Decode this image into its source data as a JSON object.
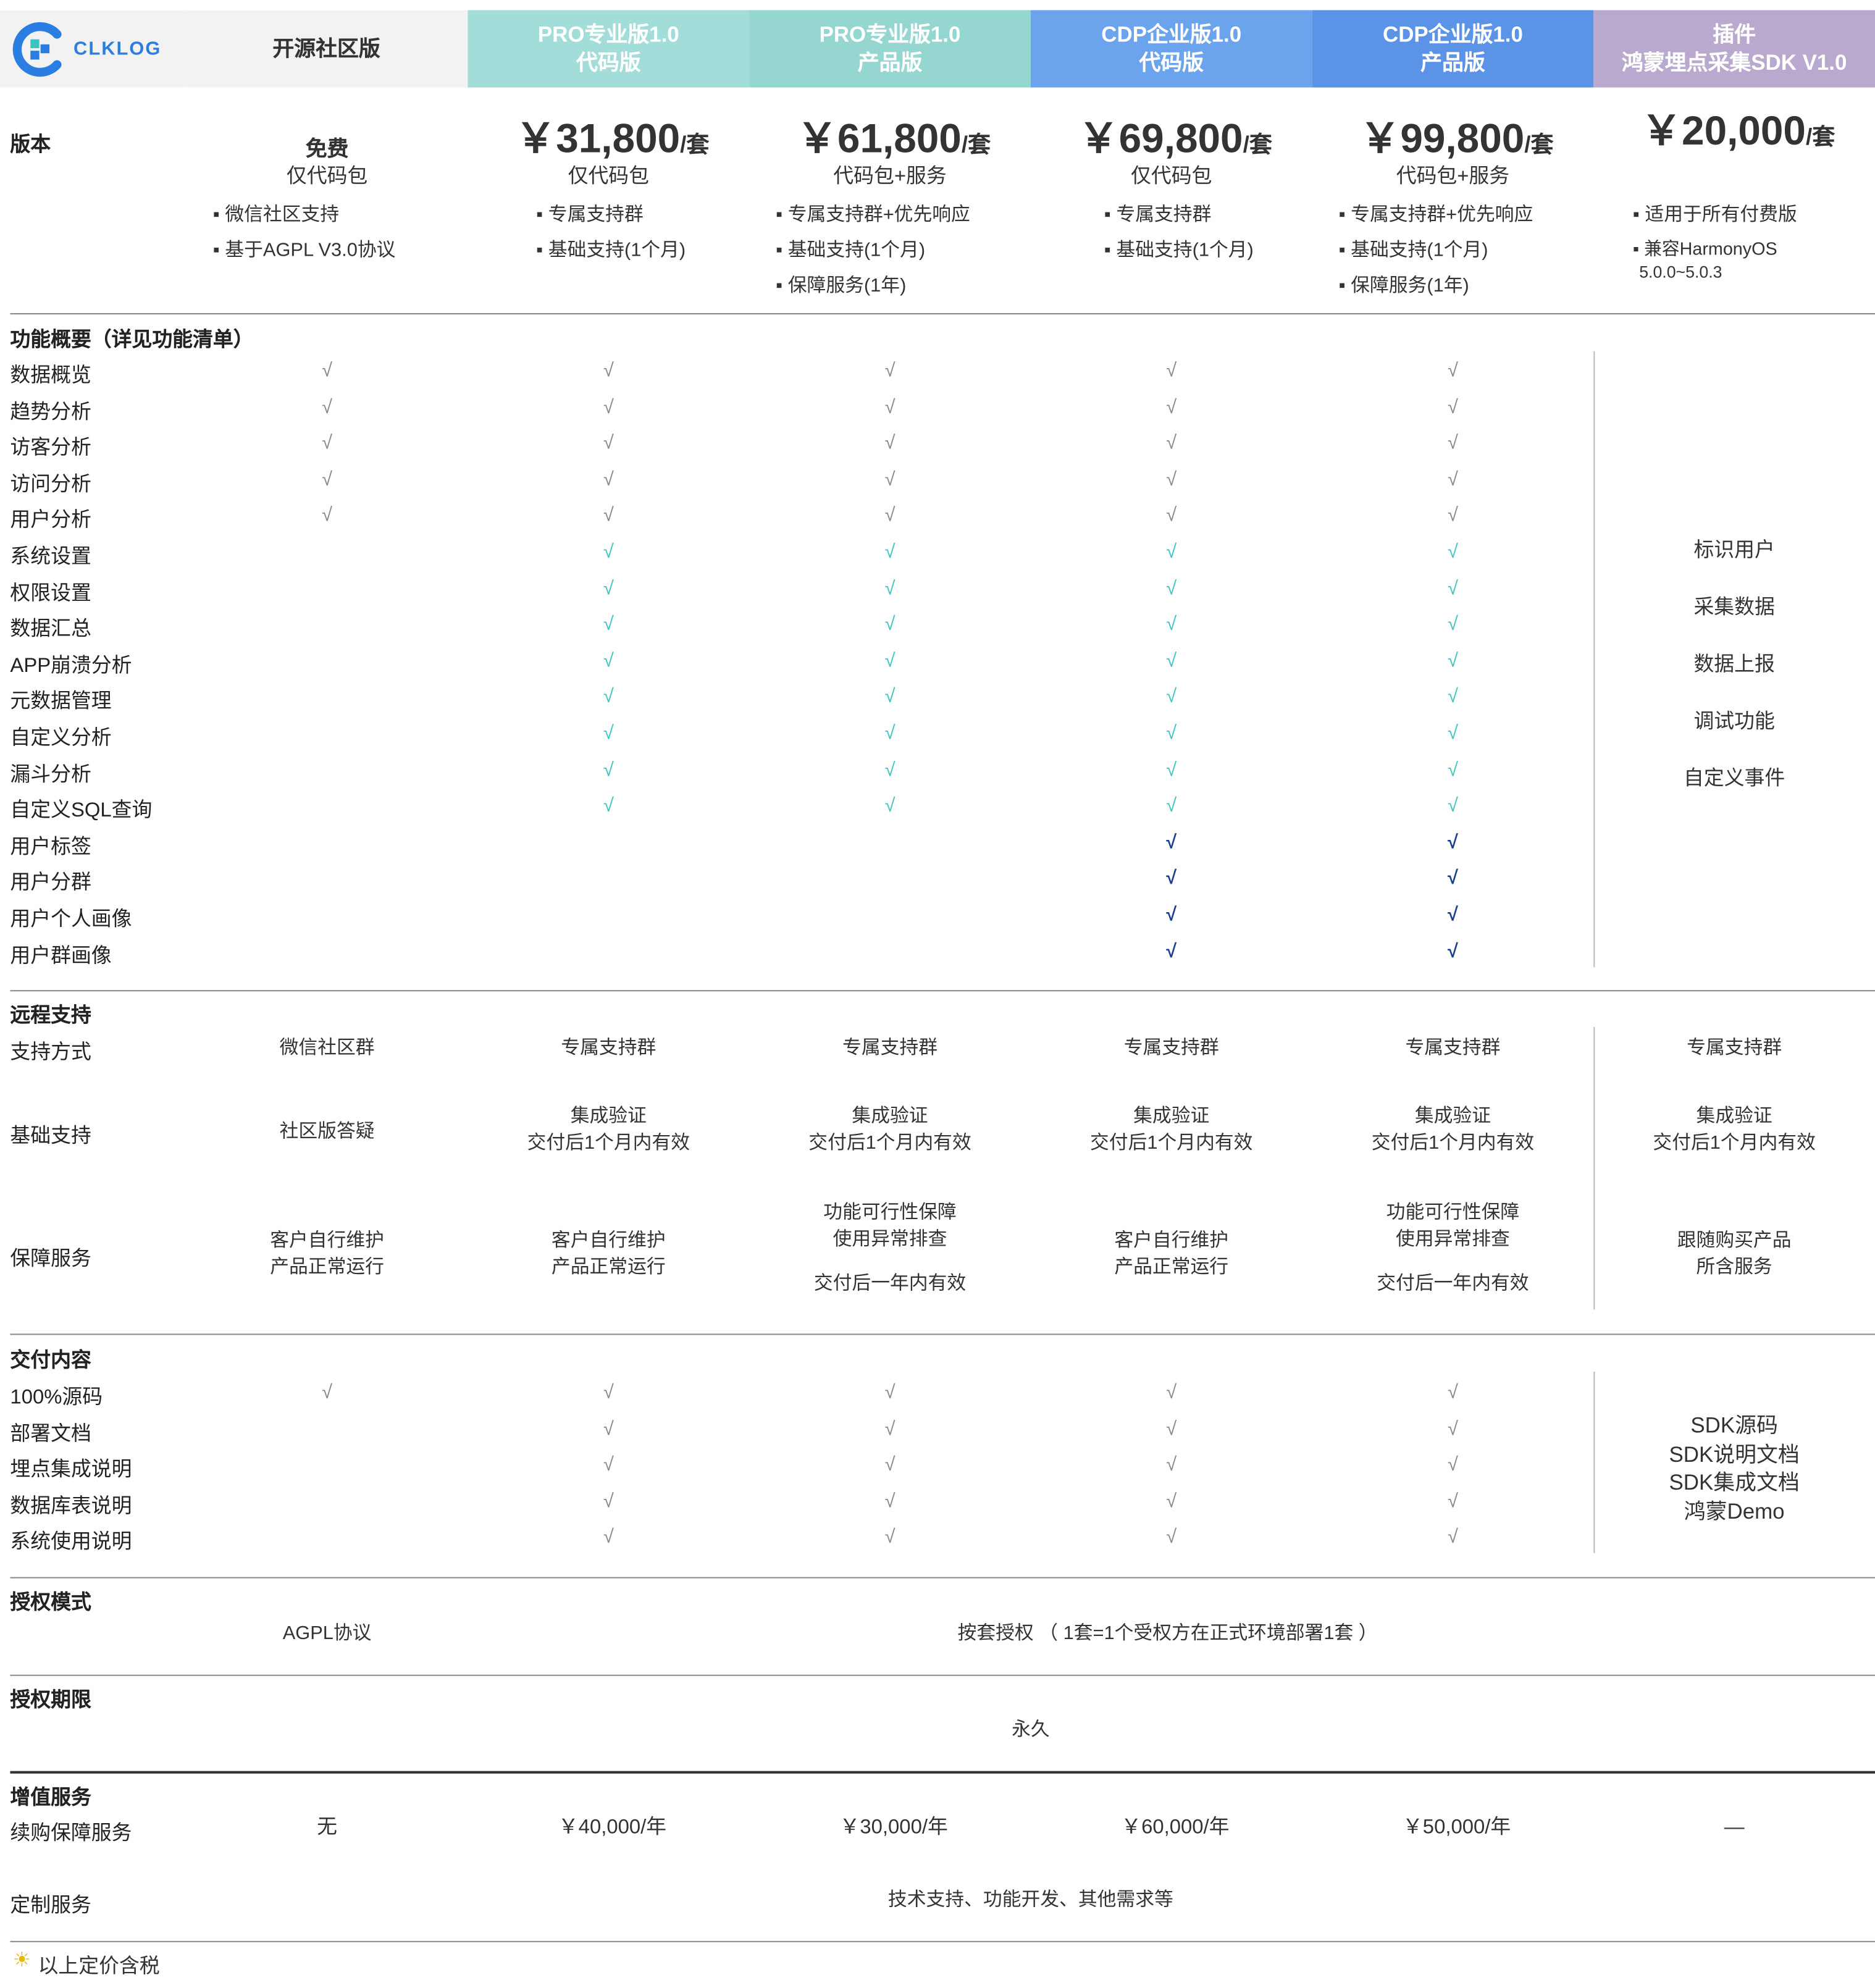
{
  "logo": {
    "text": "CLKLOG"
  },
  "columns": [
    {
      "line1": "开源社区版",
      "line2": "",
      "bg": "#f2f2f2",
      "fg": "#333333"
    },
    {
      "line1": "PRO专业版1.0",
      "line2": "代码版",
      "bg": "#a3ddd9",
      "fg": "#ffffff"
    },
    {
      "line1": "PRO专业版1.0",
      "line2": "产品版",
      "bg": "#95d6d1",
      "fg": "#ffffff"
    },
    {
      "line1": "CDP企业版1.0",
      "line2": "代码版",
      "bg": "#6ba3ec",
      "fg": "#ffffff"
    },
    {
      "line1": "CDP企业版1.0",
      "line2": "产品版",
      "bg": "#5b93e6",
      "fg": "#ffffff"
    },
    {
      "line1": "插件",
      "line2": "鸿蒙埋点采集SDK V1.0",
      "bg": "#b9a9cf",
      "fg": "#ffffff"
    }
  ],
  "version": {
    "label": "版本",
    "free": {
      "title": "免费",
      "sub": "仅代码包",
      "bullets": [
        "▪ 微信社区支持",
        "▪ 基于AGPL V3.0协议"
      ]
    },
    "prices": [
      {
        "amount": "￥31,800",
        "unit": "/套",
        "sub": "仅代码包",
        "bullets": [
          "▪ 专属支持群",
          "▪ 基础支持(1个月)"
        ]
      },
      {
        "amount": "￥61,800",
        "unit": "/套",
        "sub": "代码包+服务",
        "bullets": [
          "▪ 专属支持群+优先响应",
          "▪ 基础支持(1个月)",
          "▪ 保障服务(1年)"
        ]
      },
      {
        "amount": "￥69,800",
        "unit": "/套",
        "sub": "仅代码包",
        "bullets": [
          "▪ 专属支持群",
          "▪ 基础支持(1个月)"
        ]
      },
      {
        "amount": "￥99,800",
        "unit": "/套",
        "sub": "代码包+服务",
        "bullets": [
          "▪ 专属支持群+优先响应",
          "▪ 基础支持(1个月)",
          "▪ 保障服务(1年)"
        ]
      }
    ],
    "plugin": {
      "amount": "￥20,000",
      "unit": "/套",
      "bullets": [
        "▪ 适用于所有付费版",
        "▪ 兼容HarmonyOS",
        "5.0.0~5.0.3"
      ]
    }
  },
  "features": {
    "title": "功能概要（详见功能清单）",
    "check_mark": "√",
    "colors": {
      "gray": "#888888",
      "teal": "#3cc4c0",
      "navy": "#1b3f8f"
    },
    "rows": [
      {
        "name": "数据概览",
        "cols": [
          1,
          1,
          1,
          1,
          1
        ],
        "color": "gray"
      },
      {
        "name": "趋势分析",
        "cols": [
          1,
          1,
          1,
          1,
          1
        ],
        "color": "gray"
      },
      {
        "name": "访客分析",
        "cols": [
          1,
          1,
          1,
          1,
          1
        ],
        "color": "gray"
      },
      {
        "name": "访问分析",
        "cols": [
          1,
          1,
          1,
          1,
          1
        ],
        "color": "gray"
      },
      {
        "name": "用户分析",
        "cols": [
          1,
          1,
          1,
          1,
          1
        ],
        "color": "gray"
      },
      {
        "name": "系统设置",
        "cols": [
          0,
          1,
          1,
          1,
          1
        ],
        "color": "teal"
      },
      {
        "name": "权限设置",
        "cols": [
          0,
          1,
          1,
          1,
          1
        ],
        "color": "teal"
      },
      {
        "name": "数据汇总",
        "cols": [
          0,
          1,
          1,
          1,
          1
        ],
        "color": "teal"
      },
      {
        "name": "APP崩溃分析",
        "cols": [
          0,
          1,
          1,
          1,
          1
        ],
        "color": "teal"
      },
      {
        "name": "元数据管理",
        "cols": [
          0,
          1,
          1,
          1,
          1
        ],
        "color": "teal"
      },
      {
        "name": "自定义分析",
        "cols": [
          0,
          1,
          1,
          1,
          1
        ],
        "color": "teal"
      },
      {
        "name": "漏斗分析",
        "cols": [
          0,
          1,
          1,
          1,
          1
        ],
        "color": "teal"
      },
      {
        "name": "自定义SQL查询",
        "cols": [
          0,
          1,
          1,
          1,
          1
        ],
        "color": "teal"
      },
      {
        "name": "用户标签",
        "cols": [
          0,
          0,
          0,
          1,
          1
        ],
        "color": "navy"
      },
      {
        "name": "用户分群",
        "cols": [
          0,
          0,
          0,
          1,
          1
        ],
        "color": "navy"
      },
      {
        "name": "用户个人画像",
        "cols": [
          0,
          0,
          0,
          1,
          1
        ],
        "color": "navy"
      },
      {
        "name": "用户群画像",
        "cols": [
          0,
          0,
          0,
          1,
          1
        ],
        "color": "navy"
      }
    ],
    "plugin_items": [
      "标识用户",
      "采集数据",
      "数据上报",
      "调试功能",
      "自定义事件"
    ]
  },
  "remote": {
    "title": "远程支持",
    "rows": [
      {
        "name": "支持方式",
        "cells": [
          [
            "微信社区群"
          ],
          [
            "专属支持群"
          ],
          [
            "专属支持群"
          ],
          [
            "专属支持群"
          ],
          [
            "专属支持群"
          ],
          [
            "专属支持群"
          ]
        ]
      },
      {
        "name": "基础支持",
        "cells": [
          [
            "社区版答疑"
          ],
          [
            "集成验证",
            "交付后1个月内有效"
          ],
          [
            "集成验证",
            "交付后1个月内有效"
          ],
          [
            "集成验证",
            "交付后1个月内有效"
          ],
          [
            "集成验证",
            "交付后1个月内有效"
          ],
          [
            "集成验证",
            "交付后1个月内有效"
          ]
        ]
      },
      {
        "name": "保障服务",
        "cells": [
          [
            "客户自行维护",
            "产品正常运行"
          ],
          [
            "客户自行维护",
            "产品正常运行"
          ],
          [
            "功能可行性保障",
            "使用异常排查",
            "交付后一年内有效"
          ],
          [
            "客户自行维护",
            "产品正常运行"
          ],
          [
            "功能可行性保障",
            "使用异常排查",
            "交付后一年内有效"
          ],
          [
            "跟随购买产品",
            "所含服务"
          ]
        ]
      }
    ]
  },
  "delivery": {
    "title": "交付内容",
    "rows": [
      {
        "name": "100%源码",
        "cols": [
          1,
          1,
          1,
          1,
          1
        ]
      },
      {
        "name": "部署文档",
        "cols": [
          0,
          1,
          1,
          1,
          1
        ]
      },
      {
        "name": "埋点集成说明",
        "cols": [
          0,
          1,
          1,
          1,
          1
        ]
      },
      {
        "name": "数据库表说明",
        "cols": [
          0,
          1,
          1,
          1,
          1
        ]
      },
      {
        "name": "系统使用说明",
        "cols": [
          0,
          1,
          1,
          1,
          1
        ]
      }
    ],
    "plugin_items": [
      "SDK源码",
      "SDK说明文档",
      "SDK集成文档",
      "鸿蒙Demo"
    ]
  },
  "license_mode": {
    "title": "授权模式",
    "open": "AGPL协议",
    "paid": "按套授权 （ 1套=1个受权方在正式环境部署1套 ）"
  },
  "license_term": {
    "title": "授权期限",
    "value": "永久"
  },
  "value_added": {
    "title": "增值服务",
    "renewal": {
      "name": "续购保障服务",
      "cells": [
        "无",
        "￥40,000/年",
        "￥30,000/年",
        "￥60,000/年",
        "￥50,000/年",
        "—"
      ]
    },
    "custom": {
      "name": "定制服务",
      "value": "技术支持、功能开发、其他需求等"
    }
  },
  "footnote": {
    "icon": "☀",
    "text": "以上定价含税"
  }
}
